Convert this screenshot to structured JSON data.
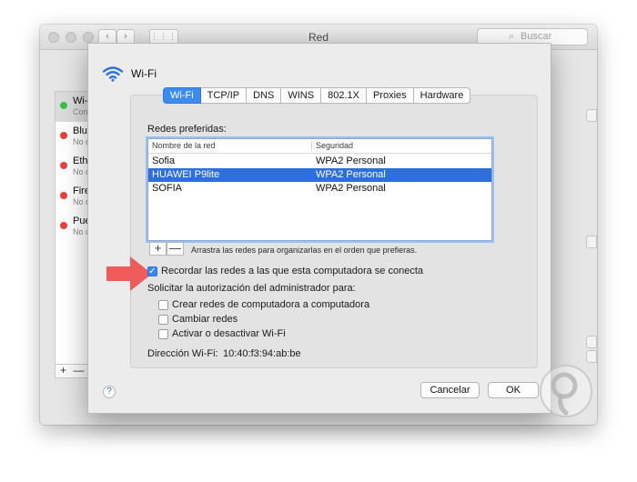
{
  "window": {
    "title": "Red",
    "search_placeholder": "Buscar"
  },
  "sidebar": {
    "services": [
      {
        "name": "Wi-",
        "sub": "Con",
        "status_color": "#3fbf4a",
        "selected": true
      },
      {
        "name": "Blue",
        "sub": "No c",
        "status_color": "#e8423c",
        "selected": false
      },
      {
        "name": "Ethe",
        "sub": "No c",
        "status_color": "#e8423c",
        "selected": false
      },
      {
        "name": "Fire",
        "sub": "No c",
        "status_color": "#e8423c",
        "selected": false
      },
      {
        "name": "Pue",
        "sub": "No c",
        "status_color": "#e8423c",
        "selected": false
      }
    ],
    "add_label": "+",
    "remove_label": "—"
  },
  "sheet": {
    "title": "Wi-Fi",
    "icon": "wifi-icon",
    "tabs": [
      {
        "label": "Wi-Fi",
        "active": true
      },
      {
        "label": "TCP/IP",
        "active": false
      },
      {
        "label": "DNS",
        "active": false
      },
      {
        "label": "WINS",
        "active": false
      },
      {
        "label": "802.1X",
        "active": false
      },
      {
        "label": "Proxies",
        "active": false
      },
      {
        "label": "Hardware",
        "active": false
      }
    ],
    "preferred_label": "Redes preferidas:",
    "columns": {
      "name": "Nombre de la red",
      "security": "Seguridad"
    },
    "networks": [
      {
        "name": "Sofia",
        "security": "WPA2 Personal",
        "selected": false
      },
      {
        "name": "HUAWEI P9lite",
        "security": "WPA2 Personal",
        "selected": true
      },
      {
        "name": "SOFIA",
        "security": "WPA2 Personal",
        "selected": false
      }
    ],
    "add_label": "+",
    "remove_label": "—",
    "drag_hint": "Arrastra las redes para organizarlas en el orden que prefieras.",
    "remember": {
      "label": "Recordar las redes a las que esta computadora se conecta",
      "checked": true
    },
    "admin_label": "Solicitar la autorización del administrador para:",
    "admin_options": [
      {
        "label": "Crear redes de computadora a computadora",
        "checked": false
      },
      {
        "label": "Cambiar redes",
        "checked": false
      },
      {
        "label": "Activar o desactivar Wi-Fi",
        "checked": false
      }
    ],
    "address_label": "Dirección Wi-Fi:",
    "address_value": "10:40:f3:94:ab:be",
    "help_label": "?",
    "cancel_label": "Cancelar",
    "ok_label": "OK"
  },
  "colors": {
    "accent": "#3d8af1",
    "selection": "#2e6fd9",
    "arrow": "#ef5a5a"
  }
}
